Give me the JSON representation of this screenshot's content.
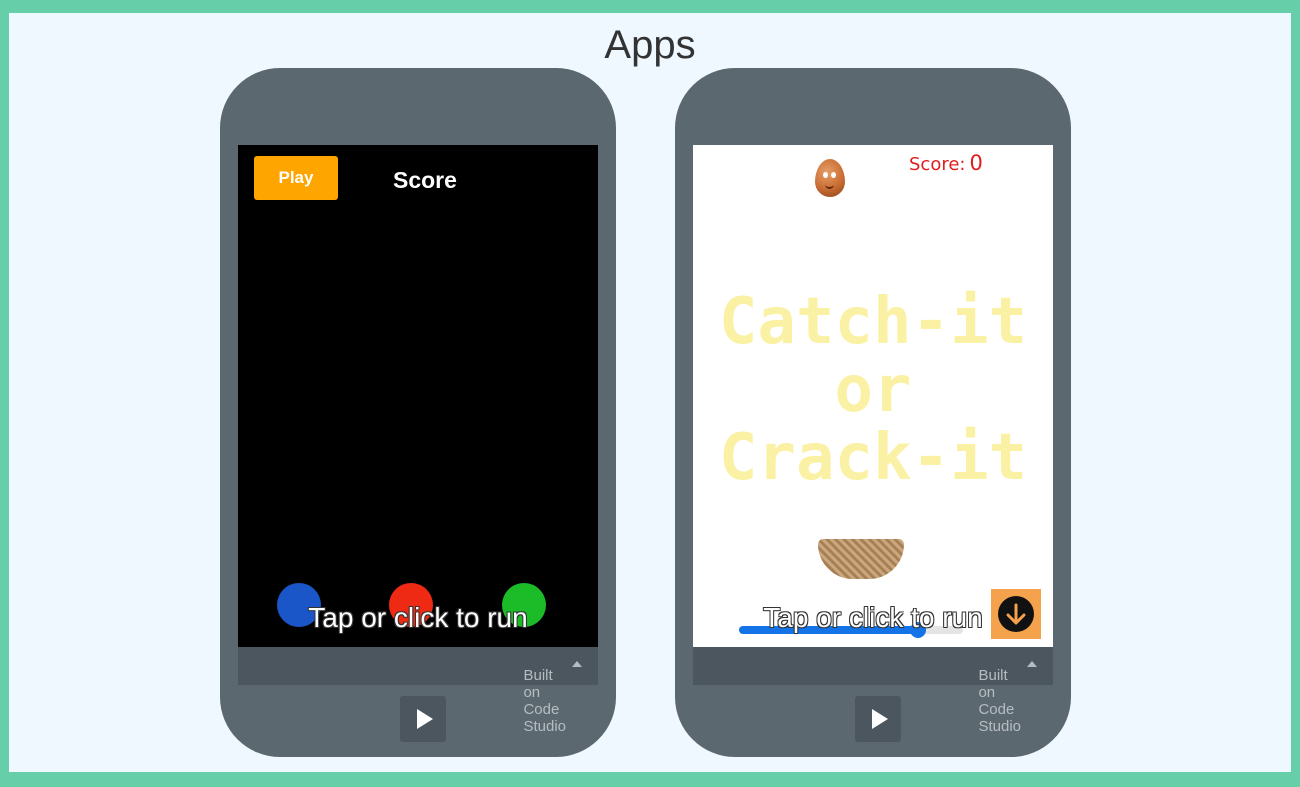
{
  "page": {
    "title": "Apps"
  },
  "apps": [
    {
      "play_label": "Play",
      "score_label": "Score",
      "tap_text": "Tap or click to run",
      "built_on": "Built on Code Studio",
      "dots": [
        "blue-dot",
        "red-dot",
        "green-dot"
      ]
    },
    {
      "score_label": "Score:",
      "score_value": "0",
      "title_lines": [
        "Catch-it",
        "or",
        "Crack-it"
      ],
      "tap_text": "Tap or click to run",
      "built_on": "Built on Code Studio",
      "slider_value": 0.8,
      "drop_icon": "arrow-down-icon"
    }
  ],
  "colors": {
    "frame": "#66cfa9",
    "panel": "#eff7ff",
    "phone": "#5b6870",
    "play_button": "#ffa500",
    "score_red": "#e21d1d",
    "title_yellow": "#fbf1a4",
    "slider_blue": "#1473e6"
  }
}
